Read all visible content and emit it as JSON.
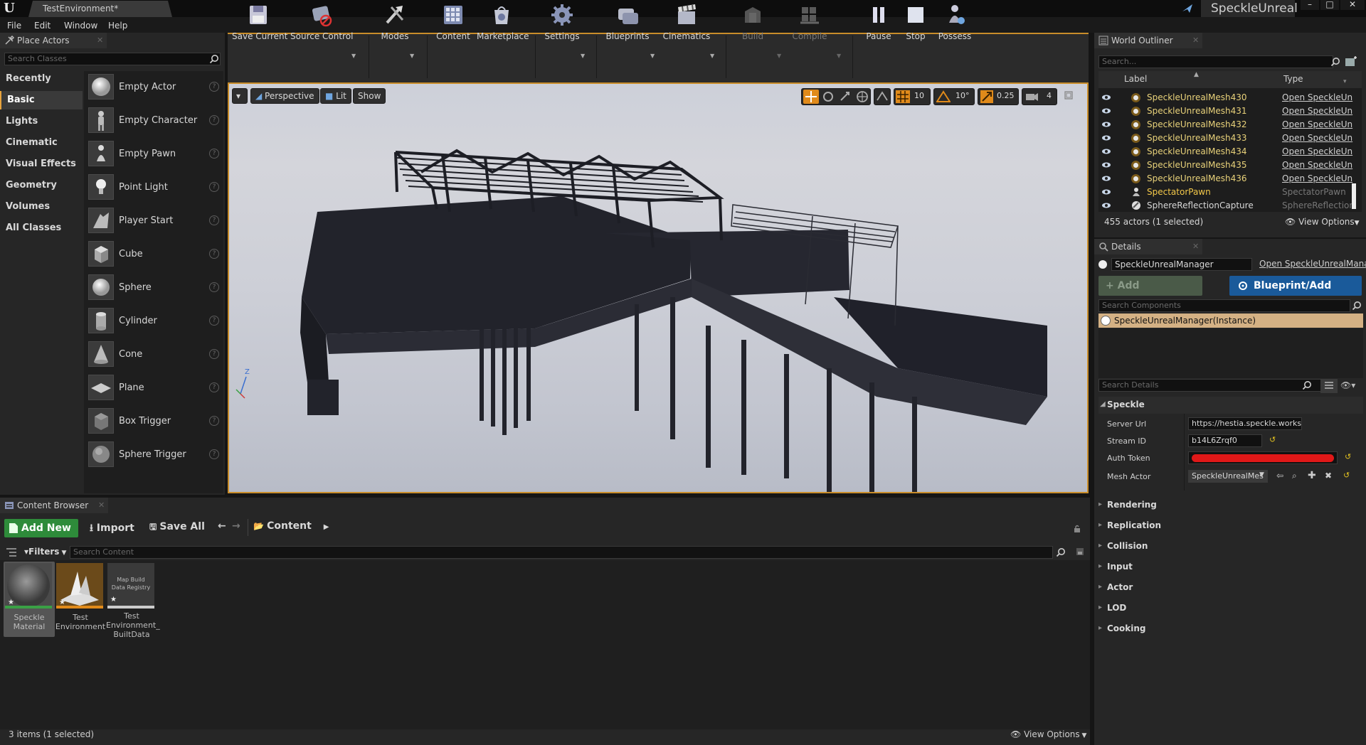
{
  "window": {
    "doc_tab": "TestEnvironment*",
    "project_name": "SpeckleUnreal",
    "min": "–",
    "max": "□",
    "close": "✕"
  },
  "menu": [
    "File",
    "Edit",
    "Window",
    "Help"
  ],
  "place_actors": {
    "title": "Place Actors",
    "search_placeholder": "Search Classes",
    "categories": [
      "Recently Placed",
      "Basic",
      "Lights",
      "Cinematic",
      "Visual Effects",
      "Geometry",
      "Volumes",
      "All Classes"
    ],
    "active_category": "Basic",
    "actors": [
      "Empty Actor",
      "Empty Character",
      "Empty Pawn",
      "Point Light",
      "Player Start",
      "Cube",
      "Sphere",
      "Cylinder",
      "Cone",
      "Plane",
      "Box Trigger",
      "Sphere Trigger"
    ],
    "help": "?"
  },
  "toolbar": {
    "save_current": "Save Current",
    "source_control": "Source Control",
    "modes": "Modes",
    "content": "Content",
    "marketplace": "Marketplace",
    "settings": "Settings",
    "blueprints": "Blueprints",
    "cinematics": "Cinematics",
    "build": "Build",
    "compile": "Compile",
    "pause": "Pause",
    "stop": "Stop",
    "possess": "Possess"
  },
  "viewport": {
    "perspective": "Perspective",
    "lit": "Lit",
    "show": "Show",
    "grid_snap": "10",
    "rot_snap": "10°",
    "scale_snap": "0.25",
    "cam_speed": "4",
    "axis_label": "Z"
  },
  "content_browser": {
    "title": "Content Browser",
    "add_new": "Add New",
    "import": "Import",
    "save_all": "Save All",
    "path": "Content",
    "filters": "Filters",
    "search_placeholder": "Search Content",
    "assets": [
      {
        "name": "Speckle Material",
        "line1": "Speckle",
        "line2": "Material",
        "line3": ""
      },
      {
        "name": "Test Environment",
        "line1": "Test",
        "line2": "Environment",
        "line3": ""
      },
      {
        "name": "Test Environment_ BuiltData",
        "line1": "Test",
        "line2": "Environment_",
        "line3": "BuiltData",
        "thumb_text1": "Map Build",
        "thumb_text2": "Data Registry"
      }
    ],
    "status": "3 items (1 selected)",
    "view_options": "View Options"
  },
  "world_outliner": {
    "title": "World Outliner",
    "search_placeholder": "Search...",
    "col_label": "Label",
    "col_type": "Type",
    "rows": [
      {
        "label": "SpeckleUnrealMesh430",
        "type": "Open SpeckleUn"
      },
      {
        "label": "SpeckleUnrealMesh431",
        "type": "Open SpeckleUn"
      },
      {
        "label": "SpeckleUnrealMesh432",
        "type": "Open SpeckleUn"
      },
      {
        "label": "SpeckleUnrealMesh433",
        "type": "Open SpeckleUn"
      },
      {
        "label": "SpeckleUnrealMesh434",
        "type": "Open SpeckleUn"
      },
      {
        "label": "SpeckleUnrealMesh435",
        "type": "Open SpeckleUn"
      },
      {
        "label": "SpeckleUnrealMesh436",
        "type": "Open SpeckleUn"
      },
      {
        "label": "SpectatorPawn",
        "type": "SpectatorPawn"
      },
      {
        "label": "SphereReflectionCapture",
        "type": "SphereReflectionC"
      }
    ],
    "status": "455 actors (1 selected)",
    "view_options": "View Options"
  },
  "details": {
    "title": "Details",
    "actor_name": "SpeckleUnrealManager",
    "open_link": "Open SpeckleUnrealMana",
    "add_component": "+ Add Component",
    "blueprint": "Blueprint/Add Script",
    "search_components": "Search Components",
    "component": "SpeckleUnrealManager(Instance)",
    "search_details": "Search Details",
    "section_speckle": "Speckle",
    "props": {
      "server_url_label": "Server Url",
      "server_url": "https://hestia.speckle.works/",
      "stream_id_label": "Stream ID",
      "stream_id": "b14L6Zrqf0",
      "auth_token_label": "Auth Token",
      "mesh_actor_label": "Mesh Actor",
      "mesh_actor": "SpeckleUnrealMes"
    },
    "sections": [
      "Rendering",
      "Replication",
      "Collision",
      "Input",
      "Actor",
      "LOD",
      "Cooking"
    ]
  },
  "colors": {
    "accent_orange": "#c98d2a",
    "add_new_green": "#2e8b3a",
    "blueprint_blue": "#1a5a9a",
    "outliner_yellow": "#e9d27a",
    "redacted_red": "#e01818"
  }
}
